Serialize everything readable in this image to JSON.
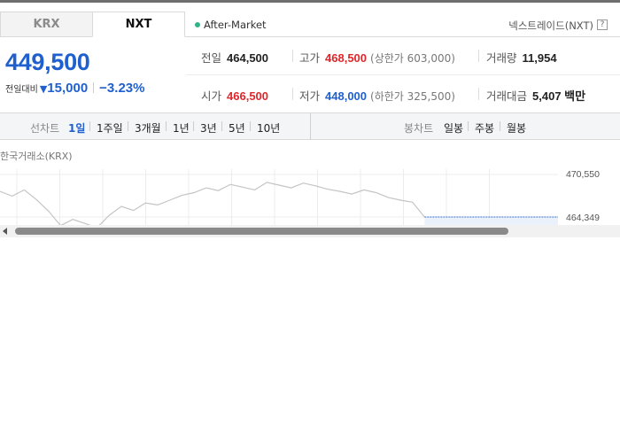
{
  "tabs": [
    {
      "label": "KRX",
      "active": false
    },
    {
      "label": "NXT",
      "active": true
    }
  ],
  "session": {
    "label": "After-Market",
    "indicator_color": "#2fb48a"
  },
  "exchange": {
    "name": "넥스트레이드(NXT)",
    "help_icon": "?"
  },
  "quote": {
    "price": "449,500",
    "change_label": "전일대비",
    "change_icon": "down-triangle-icon",
    "change_value": "15,000",
    "change_percent": "−3.23%",
    "color_down": "#1f5fce",
    "color_up": "#e0262a"
  },
  "stats": {
    "prev_close": {
      "label": "전일",
      "value": "464,500"
    },
    "high": {
      "label": "고가",
      "value": "468,500",
      "limit_label": "상한가",
      "limit_value": "603,000"
    },
    "volume": {
      "label": "거래량",
      "value": "11,954"
    },
    "open": {
      "label": "시가",
      "value": "466,500"
    },
    "low": {
      "label": "저가",
      "value": "448,000",
      "limit_label": "하한가",
      "limit_value": "325,500"
    },
    "trade_amount": {
      "label": "거래대금",
      "value": "5,407 백만"
    }
  },
  "toolbar": {
    "line_chart_label": "선차트",
    "periods": [
      "1일",
      "1주일",
      "3개월",
      "1년",
      "3년",
      "5년",
      "10년"
    ],
    "active_period": "1일",
    "candle_chart_label": "봉차트",
    "candle_periods": [
      "일봉",
      "주봉",
      "월봉"
    ]
  },
  "chart": {
    "title": "한국거래소(KRX)",
    "y_labels": [
      "470,550",
      "464,349"
    ]
  },
  "chart_data": {
    "type": "line",
    "y_ticks": [
      470550,
      464349
    ],
    "reference_line": 464349,
    "series": [
      {
        "values": [
          468100,
          467400,
          468300,
          466900,
          465200,
          463100,
          464000,
          463400,
          462800,
          464600,
          465900,
          465300,
          466400,
          466100,
          466800,
          467500,
          467900,
          468600,
          468200,
          469100,
          468700,
          468300,
          469400,
          469000,
          468600,
          469300,
          468900,
          468400,
          468100,
          467700,
          468300,
          467900,
          467200,
          466800,
          466500,
          464349,
          464349,
          464349,
          464349,
          464349,
          464349,
          464349,
          464349,
          464349,
          464349,
          464349,
          464349
        ]
      }
    ]
  }
}
